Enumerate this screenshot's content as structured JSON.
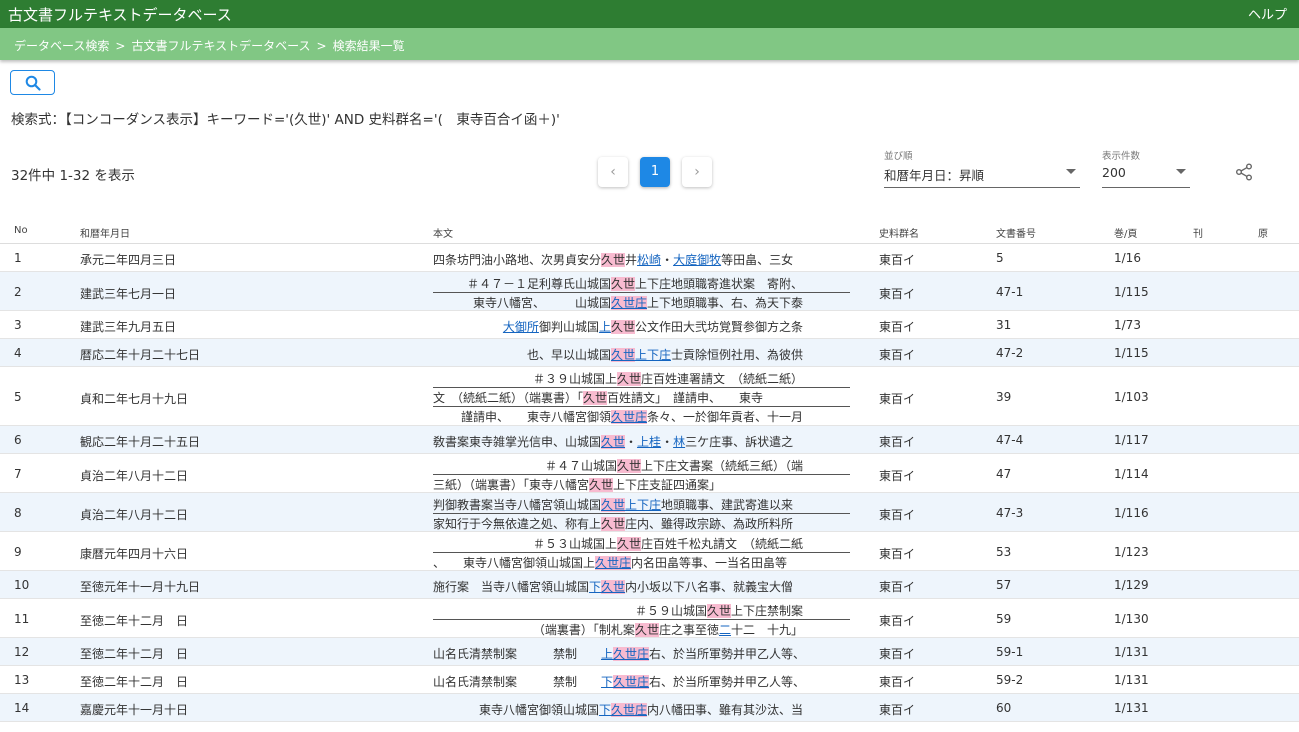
{
  "app": {
    "title": "古文書フルテキストデータベース",
    "help": "ヘルプ"
  },
  "breadcrumb": [
    "データベース検索",
    "古文書フルテキストデータベース",
    "検索結果一覧"
  ],
  "query": "検索式：【コンコーダンス表示】キーワード='(久世)' AND 史料群名='(　東寺百合イ函＋)'",
  "result_count": "32件中 1-32 を表示",
  "pager": {
    "prev": "‹",
    "current": "1",
    "next": "›"
  },
  "sort": {
    "label": "並び順",
    "value": "和暦年月日：昇順"
  },
  "per_page": {
    "label": "表示件数",
    "value": "200"
  },
  "columns": [
    "No",
    "和暦年月日",
    "本文",
    "史料群名",
    "文書番号",
    "巻/頁",
    "刊",
    "原"
  ],
  "rows": [
    {
      "no": "1",
      "date": "承元二年四月三日",
      "group": "東百イ",
      "docno": "5",
      "page": "1/16",
      "lines": [
        {
          "align": "l",
          "parts": [
            [
              "t",
              "四条坊門油小路地、次男貞安分"
            ],
            [
              "k",
              "久世"
            ],
            [
              "t",
              "井"
            ],
            [
              "l",
              "松崎"
            ],
            [
              "t",
              "・"
            ],
            [
              "l",
              "大庭御牧"
            ],
            [
              "t",
              "等田畠、三女"
            ]
          ]
        }
      ]
    },
    {
      "no": "2",
      "date": "建武三年七月一日",
      "group": "東百イ",
      "docno": "47-1",
      "page": "1/115",
      "lines": [
        {
          "align": "r",
          "parts": [
            [
              "t",
              "＃４７－１足利尊氏山城国"
            ],
            [
              "k",
              "久世"
            ],
            [
              "t",
              "上下庄地頭職寄進状案　寄附、"
            ]
          ]
        },
        {
          "align": "r",
          "parts": [
            [
              "t",
              "東寺八幡宮、　　　山城国"
            ],
            [
              "kl",
              "久世庄"
            ],
            [
              "t",
              "上下地頭職事、右、為天下泰"
            ]
          ]
        }
      ]
    },
    {
      "no": "3",
      "date": "建武三年九月五日",
      "group": "東百イ",
      "docno": "31",
      "page": "1/73",
      "lines": [
        {
          "align": "r",
          "parts": [
            [
              "l",
              "大御所"
            ],
            [
              "t",
              "御判山城国"
            ],
            [
              "l",
              "上"
            ],
            [
              "k",
              "久世"
            ],
            [
              "t",
              "公文作田大弐坊覚賢参御方之条"
            ]
          ]
        }
      ]
    },
    {
      "no": "4",
      "date": "暦応二年十月二十七日",
      "group": "東百イ",
      "docno": "47-2",
      "page": "1/115",
      "lines": [
        {
          "align": "r",
          "parts": [
            [
              "t",
              "也、早以山城国"
            ],
            [
              "kl",
              "久世"
            ],
            [
              "l",
              "上下庄"
            ],
            [
              "t",
              "士貢除恒例社用、為彼供"
            ]
          ]
        }
      ]
    },
    {
      "no": "5",
      "date": "貞和二年七月十九日",
      "group": "東百イ",
      "docno": "39",
      "page": "1/103",
      "lines": [
        {
          "align": "r",
          "parts": [
            [
              "t",
              "＃３９山城国上"
            ],
            [
              "k",
              "久世"
            ],
            [
              "t",
              "庄百姓連署請文　（続紙二紙）"
            ]
          ]
        },
        {
          "align": "l",
          "parts": [
            [
              "t",
              "文　（続紙二紙）（端裏書）「"
            ],
            [
              "k",
              "久世"
            ],
            [
              "t",
              "百姓請文」　謹請申、　　東寺"
            ]
          ]
        },
        {
          "align": "r",
          "parts": [
            [
              "t",
              "謹請申、　　東寺八幡宮御領"
            ],
            [
              "kl",
              "久世庄"
            ],
            [
              "t",
              "条々、一於御年貢者、十一月"
            ]
          ]
        }
      ]
    },
    {
      "no": "6",
      "date": "観応二年十月二十五日",
      "group": "東百イ",
      "docno": "47-4",
      "page": "1/117",
      "lines": [
        {
          "align": "l",
          "parts": [
            [
              "t",
              "敎書案東寺雑掌光信申、山城国"
            ],
            [
              "kl",
              "久世"
            ],
            [
              "t",
              "・"
            ],
            [
              "l",
              "上桂"
            ],
            [
              "t",
              "・"
            ],
            [
              "l",
              "林"
            ],
            [
              "t",
              "三ケ庄事、訴状遣之"
            ]
          ]
        }
      ]
    },
    {
      "no": "7",
      "date": "貞治二年八月十二日",
      "group": "東百イ",
      "docno": "47",
      "page": "1/114",
      "lines": [
        {
          "align": "r",
          "parts": [
            [
              "t",
              "＃４７山城国"
            ],
            [
              "k",
              "久世"
            ],
            [
              "t",
              "上下庄文書案（続紙三紙）（端"
            ]
          ]
        },
        {
          "align": "l",
          "parts": [
            [
              "t",
              "三紙）（端裏書）「東寺八幡宮"
            ],
            [
              "k",
              "久世"
            ],
            [
              "t",
              "上下庄支証四通案」"
            ]
          ]
        }
      ]
    },
    {
      "no": "8",
      "date": "貞治二年八月十二日",
      "group": "東百イ",
      "docno": "47-3",
      "page": "1/116",
      "lines": [
        {
          "align": "l",
          "parts": [
            [
              "t",
              "判御教書案当寺八幡宮領山城国"
            ],
            [
              "kl",
              "久世"
            ],
            [
              "l",
              "上下庄"
            ],
            [
              "t",
              "地頭職事、建武寄進以来"
            ]
          ]
        },
        {
          "align": "l",
          "parts": [
            [
              "t",
              "家知行于今無依違之処、称有上"
            ],
            [
              "k",
              "久世"
            ],
            [
              "t",
              "庄内、雖得政宗跡、為政所料所"
            ]
          ]
        }
      ]
    },
    {
      "no": "9",
      "date": "康暦元年四月十六日",
      "group": "東百イ",
      "docno": "53",
      "page": "1/123",
      "lines": [
        {
          "align": "r",
          "parts": [
            [
              "t",
              "＃５３山城国上"
            ],
            [
              "k",
              "久世"
            ],
            [
              "t",
              "庄百姓千松丸請文　（続紙二紙"
            ]
          ]
        },
        {
          "align": "l",
          "parts": [
            [
              "t",
              "、　　東寺八幡宮御領山城国上"
            ],
            [
              "kl",
              "久世庄"
            ],
            [
              "t",
              "内名田畠等事、一当名田畠等"
            ]
          ]
        }
      ]
    },
    {
      "no": "10",
      "date": "至徳元年十一月十九日",
      "group": "東百イ",
      "docno": "57",
      "page": "1/129",
      "lines": [
        {
          "align": "l",
          "parts": [
            [
              "t",
              "施行案　当寺八幡宮領山城国"
            ],
            [
              "l",
              "下"
            ],
            [
              "kl",
              "久世"
            ],
            [
              "t",
              "内小坂以下八名事、就義宝大僧"
            ]
          ]
        }
      ]
    },
    {
      "no": "11",
      "date": "至徳二年十二月　日",
      "group": "東百イ",
      "docno": "59",
      "page": "1/130",
      "lines": [
        {
          "align": "r",
          "parts": [
            [
              "t",
              "＃５９山城国"
            ],
            [
              "k",
              "久世"
            ],
            [
              "t",
              "上下庄禁制案"
            ]
          ]
        },
        {
          "align": "r",
          "parts": [
            [
              "t",
              "（端裏書）「制札案"
            ],
            [
              "k",
              "久世"
            ],
            [
              "t",
              "庄之事至徳"
            ],
            [
              "l",
              "二"
            ],
            [
              "t",
              "十二　十九」"
            ]
          ]
        }
      ]
    },
    {
      "no": "12",
      "date": "至徳二年十二月　日",
      "group": "東百イ",
      "docno": "59-1",
      "page": "1/131",
      "lines": [
        {
          "align": "l",
          "parts": [
            [
              "t",
              "山名氏清禁制案　　　禁制　　"
            ],
            [
              "l",
              "上"
            ],
            [
              "kl",
              "久世庄"
            ],
            [
              "t",
              "右、於当所軍勢并甲乙人等、"
            ]
          ]
        }
      ]
    },
    {
      "no": "13",
      "date": "至徳二年十二月　日",
      "group": "東百イ",
      "docno": "59-2",
      "page": "1/131",
      "lines": [
        {
          "align": "l",
          "parts": [
            [
              "t",
              "山名氏清禁制案　　　禁制　　"
            ],
            [
              "l",
              "下"
            ],
            [
              "kl",
              "久世庄"
            ],
            [
              "t",
              "右、於当所軍勢并甲乙人等、"
            ]
          ]
        }
      ]
    },
    {
      "no": "14",
      "date": "嘉慶元年十一月十日",
      "group": "東百イ",
      "docno": "60",
      "page": "1/131",
      "lines": [
        {
          "align": "r",
          "parts": [
            [
              "t",
              "東寺八幡宮御領山城国"
            ],
            [
              "l",
              "下"
            ],
            [
              "kl",
              "久世庄"
            ],
            [
              "t",
              "内八幡田事、雖有其沙汰、当"
            ]
          ]
        }
      ]
    }
  ],
  "colors": {
    "topbar": "#2e7d32",
    "crumbbar": "#81c784",
    "accent": "#1e88e5",
    "keyword_bg": "#f8bbd0",
    "link": "#1565c0",
    "alt_row": "#eef5fc"
  }
}
